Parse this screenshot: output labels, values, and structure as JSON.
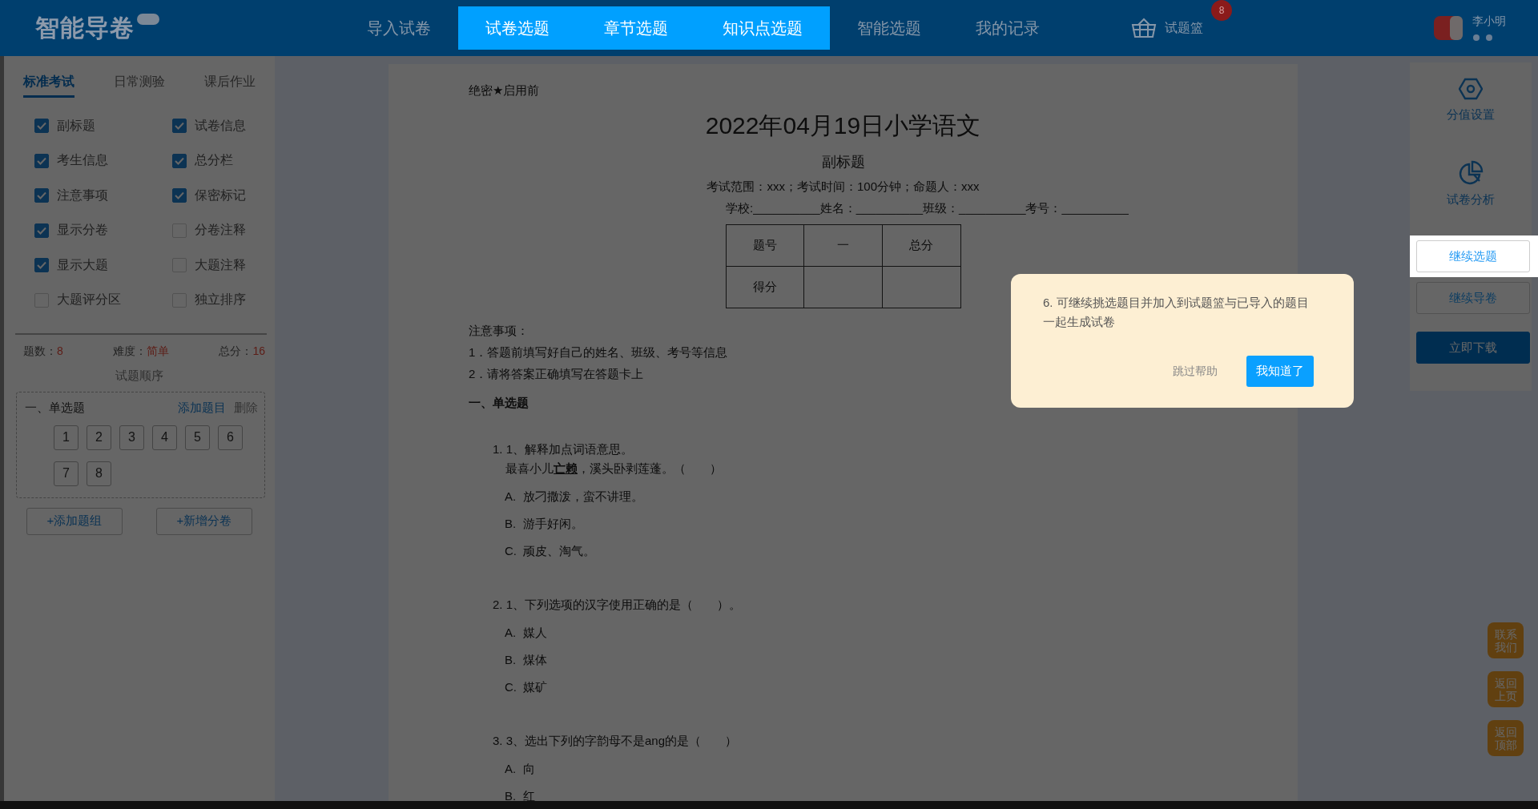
{
  "header": {
    "logo": "智能导卷",
    "nav": [
      {
        "label": "导入试卷",
        "selected": false
      },
      {
        "label": "试卷选题",
        "selected": true
      },
      {
        "label": "章节选题",
        "selected": true
      },
      {
        "label": "知识点选题",
        "selected": true
      },
      {
        "label": "智能选题",
        "selected": false
      },
      {
        "label": "我的记录",
        "selected": false
      }
    ],
    "basket": {
      "label": "试题篮",
      "count": "8"
    },
    "user": {
      "name": "李小明"
    }
  },
  "left_panel": {
    "tabs": [
      {
        "label": "标准考试",
        "selected": true
      },
      {
        "label": "日常测验",
        "selected": false
      },
      {
        "label": "课后作业",
        "selected": false
      }
    ],
    "options": [
      {
        "label": "副标题",
        "checked": true
      },
      {
        "label": "试卷信息",
        "checked": true
      },
      {
        "label": "考生信息",
        "checked": true
      },
      {
        "label": "总分栏",
        "checked": true
      },
      {
        "label": "注意事项",
        "checked": true
      },
      {
        "label": "保密标记",
        "checked": true
      },
      {
        "label": "显示分卷",
        "checked": true
      },
      {
        "label": "分卷注释",
        "checked": false
      },
      {
        "label": "显示大题",
        "checked": true
      },
      {
        "label": "大题注释",
        "checked": false
      },
      {
        "label": "大题评分区",
        "checked": false
      },
      {
        "label": "独立排序",
        "checked": false
      }
    ],
    "stats": [
      {
        "label": "题数：",
        "value": "8"
      },
      {
        "label": "难度：",
        "value": "简单"
      },
      {
        "label": "总分：",
        "value": "16"
      }
    ],
    "order_title": "试题顺序",
    "group": {
      "title": "一、单选题",
      "add": "添加题目",
      "delete": "删除",
      "numbers": [
        "1",
        "2",
        "3",
        "4",
        "5",
        "6",
        "7",
        "8"
      ]
    },
    "buttons": [
      "+添加题组",
      "+新增分卷"
    ]
  },
  "paper": {
    "secret": "绝密★启用前",
    "title": "2022年04月19日小学语文",
    "subtitle": "副标题",
    "info": "考试范围：xxx；考试时间：100分钟；命题人：xxx",
    "fields": "学校:__________姓名：__________班级：__________考号：__________",
    "score_table": {
      "columns": [
        "题号",
        "一",
        "总分"
      ],
      "row_label": "得分"
    },
    "notes_title": "注意事项：",
    "notes": [
      "1．答题前填写好自己的姓名、班级、考号等信息",
      "2．请将答案正确填写在答题卡上"
    ],
    "section": "一、单选题",
    "questions": [
      {
        "number": "1.",
        "text": "1、解释加点词语意思。",
        "line2": "最喜小儿**亡赖**，溪头卧剥莲蓬。（　　）",
        "options": [
          {
            "letter": "A.",
            "text": "放刁撒泼，蛮不讲理。"
          },
          {
            "letter": "B.",
            "text": "游手好闲。"
          },
          {
            "letter": "C.",
            "text": "顽皮、淘气。"
          }
        ]
      },
      {
        "number": "2.",
        "text": "1、下列选项的汉字使用正确的是（　　）。",
        "options": [
          {
            "letter": "A.",
            "text": "媒人"
          },
          {
            "letter": "B.",
            "text": "煤体"
          },
          {
            "letter": "C.",
            "text": "媒矿"
          }
        ]
      },
      {
        "number": "3.",
        "text": "3、选出下列的字韵母不是ang的是（　　）",
        "options": [
          {
            "letter": "A.",
            "text": "向"
          },
          {
            "letter": "B.",
            "text": "红"
          }
        ]
      }
    ]
  },
  "right_panel": {
    "tools": [
      {
        "kind": "score",
        "label": "分值设置"
      },
      {
        "kind": "analysis",
        "label": "试卷分析"
      }
    ],
    "buttons": [
      {
        "label": "继续选题",
        "kind": "outline",
        "highlighted": true
      },
      {
        "label": "继续导卷",
        "kind": "outline",
        "highlighted": false
      },
      {
        "label": "立即下载",
        "kind": "primary",
        "highlighted": false
      }
    ]
  },
  "float_buttons": [
    "联系我们",
    "返回上页",
    "返回顶部"
  ],
  "guide": {
    "text": "6. 可继续挑选题目并加入到试题篮与已导入的题目一起生成试卷",
    "skip": "跳过帮助",
    "ok": "我知道了"
  }
}
